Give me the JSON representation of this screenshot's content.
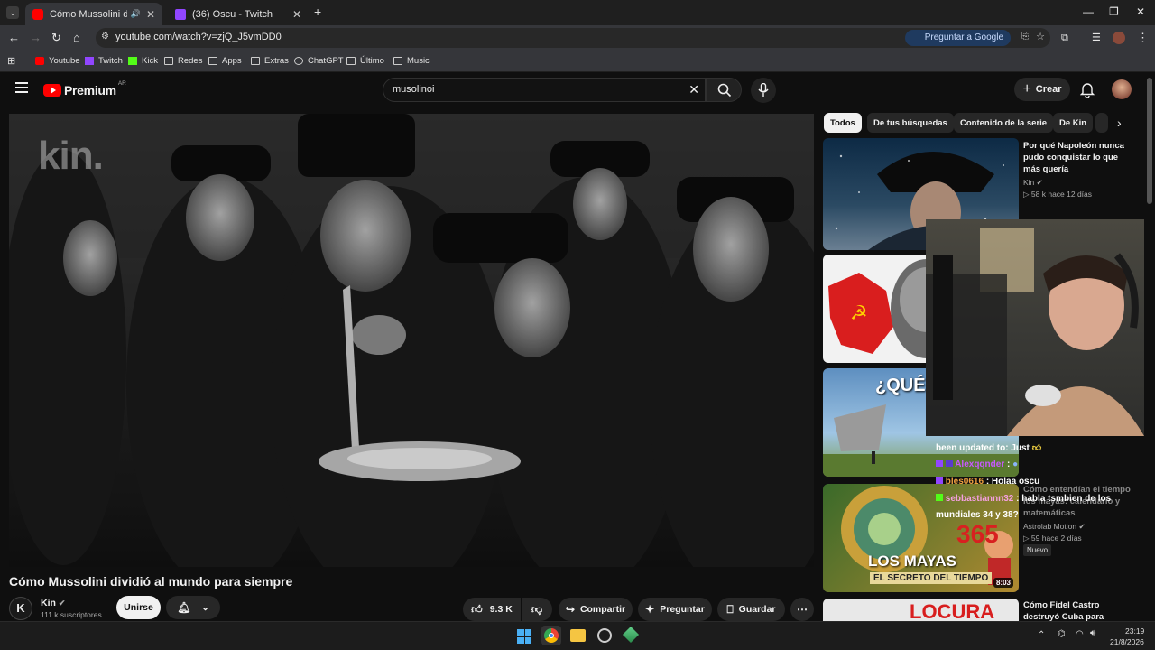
{
  "browser": {
    "tabs": [
      {
        "title": "Cómo Mussolini dividió al m",
        "active": true,
        "color": "#ff0000"
      },
      {
        "title": "(36) Oscu - Twitch",
        "active": false,
        "color": "#9146ff"
      }
    ],
    "new_tab": "+",
    "url": "youtube.com/watch?v=zjQ_J5vmDD0",
    "ask_google": "Preguntar a Google",
    "bookmarks": [
      "Youtube",
      "Twitch",
      "Kick",
      "Redes",
      "Apps",
      "Extras",
      "ChatGPT",
      "Último",
      "Music"
    ]
  },
  "youtube": {
    "logo_text": "Premium",
    "logo_badge": "AR",
    "search_query": "musolinoi",
    "create_label": "Crear",
    "video_watermark": "kin.",
    "video_title": "Cómo Mussolini dividió al mundo para siempre",
    "channel": {
      "name": "Kin",
      "subscribers": "111 k suscriptores",
      "join_label": "Unirse"
    },
    "actions": {
      "likes": "9.3 K",
      "share": "Compartir",
      "ask": "Preguntar",
      "save": "Guardar"
    },
    "chips": [
      "Todos",
      "De tus búsquedas",
      "Contenido de la serie",
      "De Kin"
    ],
    "recommendations": [
      {
        "title": "Por qué Napoleón nunca pudo conquistar lo que más quería",
        "channel": "Kin",
        "meta": "58 k  hace 12 días"
      },
      {
        "title": "",
        "channel": "",
        "meta": ""
      },
      {
        "title": "",
        "channel": "",
        "meta": ""
      },
      {
        "title": "Cómo entendían el tiempo los mayas: calendario y matemáticas",
        "channel": "Astrolab Motion",
        "meta": "59  hace 2 días",
        "badge": "Nuevo",
        "duration": "8:03",
        "thumb_text1": "LOS MAYAS",
        "thumb_text2": "EL SECRETO DEL TIEMPO",
        "thumb_num": "365"
      },
      {
        "title": "Cómo Fidel Castro destruyó Cuba para siempre",
        "channel": "",
        "meta": "",
        "thumb_text": "LOCURA"
      }
    ],
    "thumb3_text": "¿QUÉ ES"
  },
  "chat": {
    "lines": [
      {
        "user": "",
        "text": "been updated to: Just"
      },
      {
        "user": "Alexqqnder",
        "text": ":"
      },
      {
        "user": "bles0616",
        "text": ": Holaa oscu"
      },
      {
        "user": "sebbastiannn32",
        "text": ": habla tsmbien de los mundiales 34 y 38?"
      }
    ]
  },
  "taskbar": {
    "time": "23:19",
    "date": "21/8/2026"
  },
  "colors": {
    "youtube_red": "#ff0000",
    "twitch_purple": "#9146ff",
    "kick_green": "#53fc18"
  }
}
